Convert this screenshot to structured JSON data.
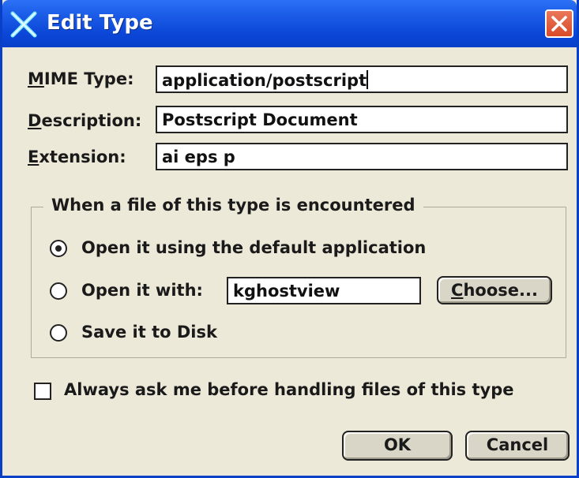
{
  "window": {
    "title": "Edit Type",
    "close_glyph": "✕"
  },
  "fields": {
    "mime_type": {
      "label_first": "M",
      "label_rest": "IME Type:",
      "value": "application/postscript"
    },
    "description": {
      "label_first": "D",
      "label_rest": "escription:",
      "value": "Postscript Document"
    },
    "extension": {
      "label_first": "E",
      "label_rest": "xtension:",
      "value": "ai eps p"
    }
  },
  "group": {
    "title": "When a file of this type is encountered",
    "options": [
      {
        "label": "Open it using the default application",
        "selected": true
      },
      {
        "label": "Open it with:",
        "selected": false
      },
      {
        "label": "Save it to Disk",
        "selected": false
      }
    ],
    "open_with_value": "kghostview",
    "choose_first": "C",
    "choose_rest": "hoose..."
  },
  "always_ask": {
    "label": "Always ask me before handling files of this type",
    "checked": false
  },
  "buttons": {
    "ok": "OK",
    "cancel": "Cancel"
  },
  "icons": {
    "app": "x-icon",
    "close": "close-icon"
  },
  "colors": {
    "titlebar": "#0a45d6",
    "close": "#d94a28",
    "background": "#ece9d8"
  }
}
